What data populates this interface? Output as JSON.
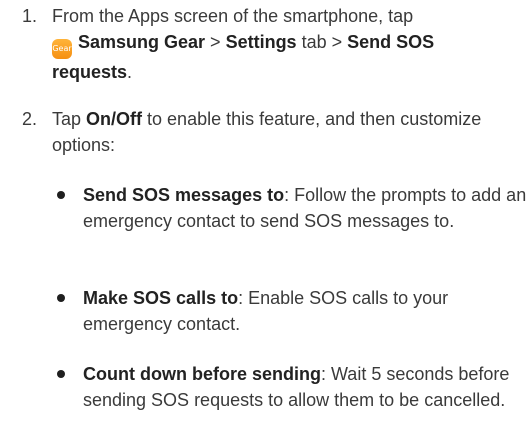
{
  "steps": [
    {
      "number": "1.",
      "parts": {
        "lead": "From the Apps screen of the smartphone, tap",
        "app_icon_text": "Gear",
        "app_name": "Samsung Gear",
        "sep1": " > ",
        "tab": "Settings",
        "tab_suffix": " tab > ",
        "option": "Send SOS requests",
        "end": "."
      }
    },
    {
      "number": "2.",
      "parts": {
        "lead": "Tap ",
        "toggle": "On/Off",
        "rest": " to enable this feature, and then customize options:"
      }
    }
  ],
  "options": [
    {
      "title": "Send SOS messages to",
      "description": ": Follow the prompts to add an emergency contact to send SOS messages to."
    },
    {
      "title": "Make SOS calls to",
      "description": ": Enable SOS calls to your emergency contact."
    },
    {
      "title": "Count down before sending",
      "description": ": Wait 5 seconds before sending SOS requests to allow them to be cancelled."
    }
  ],
  "colors": {
    "text": "#3a3a3a",
    "bold": "#222222",
    "app_icon": "#f7a21b"
  }
}
